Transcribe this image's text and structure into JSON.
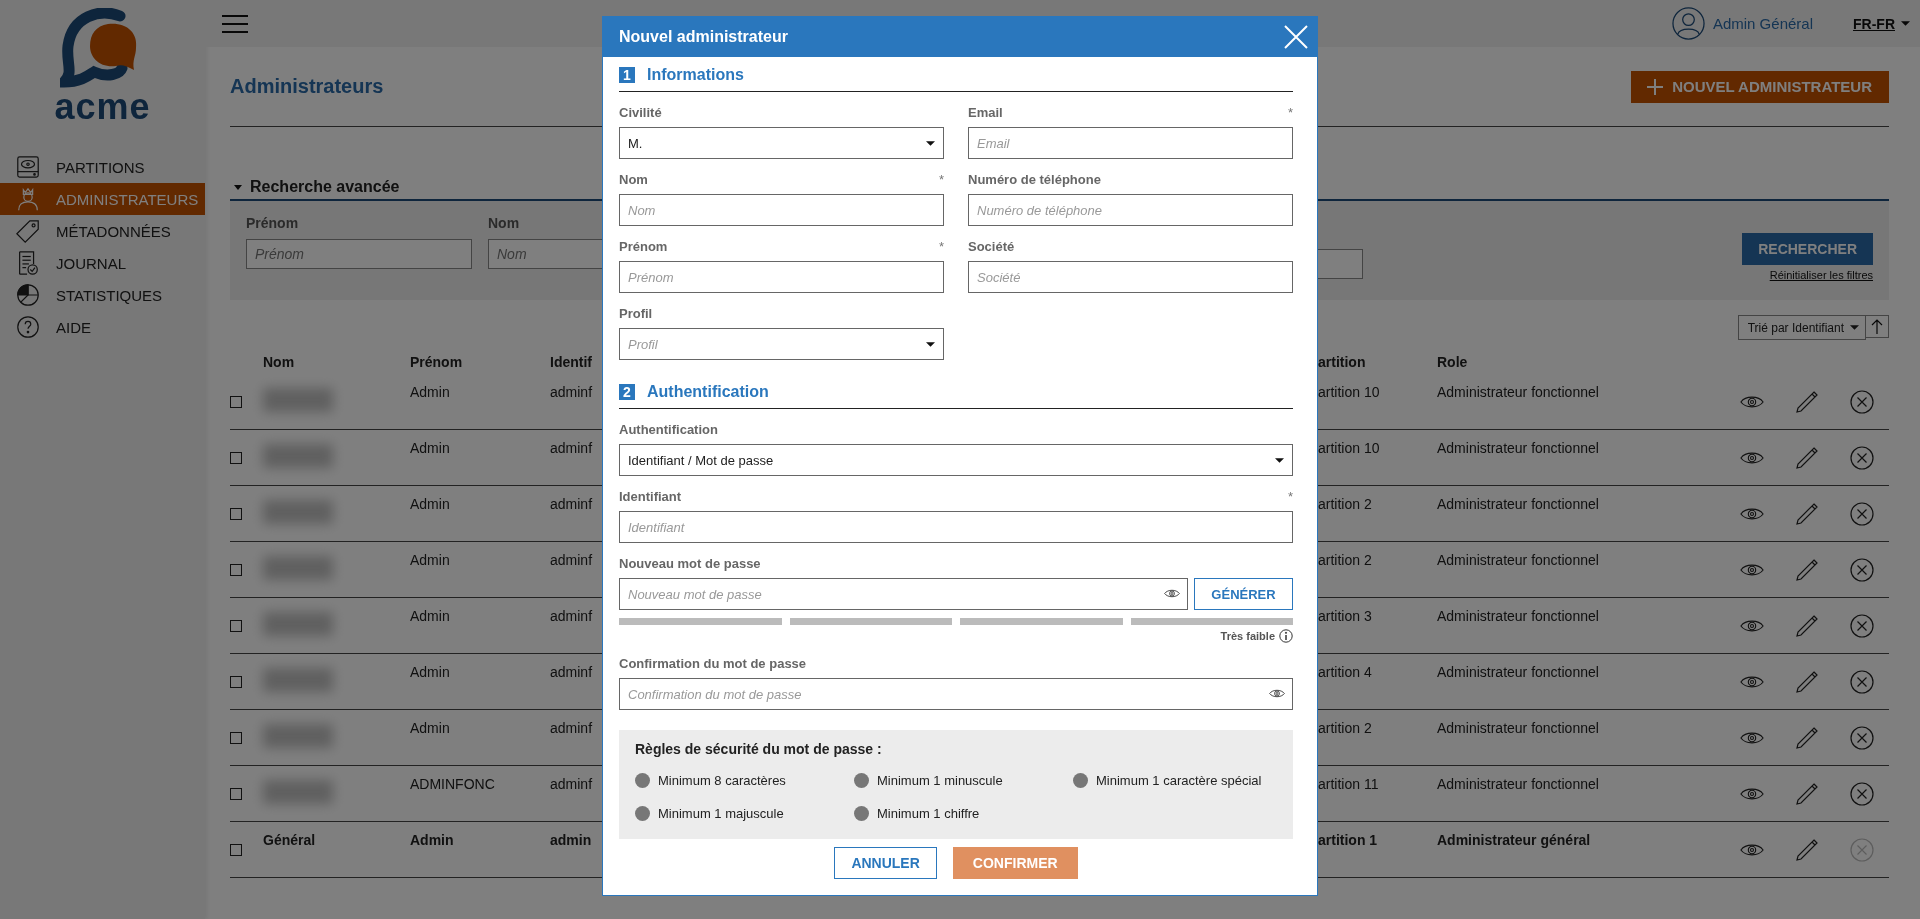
{
  "logo": {
    "text": "acme"
  },
  "sidebar": {
    "items": [
      {
        "label": "PARTITIONS",
        "selected": false
      },
      {
        "label": "ADMINISTRATEURS",
        "selected": true
      },
      {
        "label": "MÉTADONNÉES",
        "selected": false
      },
      {
        "label": "JOURNAL",
        "selected": false
      },
      {
        "label": "STATISTIQUES",
        "selected": false
      },
      {
        "label": "AIDE",
        "selected": false
      }
    ]
  },
  "header": {
    "user": "Admin Général",
    "language": "FR-FR"
  },
  "page": {
    "title": "Administrateurs",
    "new_button": "NOUVEL ADMINISTRATEUR"
  },
  "search": {
    "title": "Recherche avancée",
    "expanded": true,
    "fields": [
      {
        "label": "Prénom",
        "placeholder": "Prénom"
      },
      {
        "label": "Nom",
        "placeholder": "Nom"
      }
    ],
    "button": "RECHERCHER",
    "reset_link": "Réinitialiser les filtres"
  },
  "sort": {
    "value": "Trié par Identifiant"
  },
  "table": {
    "columns": [
      "Nom",
      "Prénom",
      "Identif",
      "artition",
      "Role"
    ],
    "rows": [
      {
        "checked": false,
        "nom_blurred": true,
        "emphasized": false,
        "prenom": "Admin",
        "identifiant": "adminf",
        "partition": "artition 10",
        "role": "Administrateur fonctionnel",
        "delete_disabled": false
      },
      {
        "checked": false,
        "nom_blurred": true,
        "emphasized": false,
        "prenom": "Admin",
        "identifiant": "adminf",
        "partition": "artition 10",
        "role": "Administrateur fonctionnel",
        "delete_disabled": false
      },
      {
        "checked": false,
        "nom_blurred": true,
        "emphasized": false,
        "prenom": "Admin",
        "identifiant": "adminf",
        "partition": "artition 2",
        "role": "Administrateur fonctionnel",
        "delete_disabled": false
      },
      {
        "checked": false,
        "nom_blurred": true,
        "emphasized": false,
        "prenom": "Admin",
        "identifiant": "adminf",
        "partition": "artition 2",
        "role": "Administrateur fonctionnel",
        "delete_disabled": false
      },
      {
        "checked": false,
        "nom_blurred": true,
        "emphasized": false,
        "prenom": "Admin",
        "identifiant": "adminf",
        "partition": "artition 3",
        "role": "Administrateur fonctionnel",
        "delete_disabled": false
      },
      {
        "checked": false,
        "nom_blurred": true,
        "emphasized": false,
        "prenom": "Admin",
        "identifiant": "adminf",
        "partition": "artition 4",
        "role": "Administrateur fonctionnel",
        "delete_disabled": false
      },
      {
        "checked": false,
        "nom_blurred": true,
        "emphasized": false,
        "prenom": "Admin",
        "identifiant": "adminf",
        "partition": "artition 2",
        "role": "Administrateur fonctionnel",
        "delete_disabled": false
      },
      {
        "checked": false,
        "nom_blurred": true,
        "emphasized": false,
        "prenom": "ADMINFONC",
        "identifiant": "adminf",
        "partition": "artition 11",
        "role": "Administrateur fonctionnel",
        "delete_disabled": false
      },
      {
        "checked": false,
        "nom_blurred": false,
        "nom": "Général",
        "emphasized": true,
        "prenom": "Admin",
        "identifiant": "admin",
        "partition": "artition 1",
        "role": "Administrateur général",
        "delete_disabled": true
      }
    ]
  },
  "dialog": {
    "title": "Nouvel administrateur",
    "section_1": {
      "number": "1",
      "title": "Informations",
      "fields": [
        {
          "kind": "select",
          "label": "Civilité",
          "value": "M."
        },
        {
          "kind": "text",
          "label": "Email",
          "placeholder": "Email",
          "required_mark": "*"
        },
        {
          "kind": "text",
          "label": "Nom",
          "placeholder": "Nom",
          "required_mark": "*"
        },
        {
          "kind": "text",
          "label": "Numéro de téléphone",
          "placeholder": "Numéro de téléphone"
        },
        {
          "kind": "text",
          "label": "Prénom",
          "placeholder": "Prénom",
          "required_mark": "*"
        },
        {
          "kind": "text",
          "label": "Société",
          "placeholder": "Société"
        },
        {
          "kind": "select",
          "label": "Profil",
          "placeholder": "Profil"
        }
      ]
    },
    "section_2": {
      "number": "2",
      "title": "Authentification",
      "fields": [
        {
          "kind": "select",
          "label": "Authentification",
          "value": "Identifiant / Mot de passe"
        },
        {
          "kind": "text",
          "label": "Identifiant",
          "placeholder": "Identifiant",
          "required_mark": "*"
        },
        {
          "kind": "password",
          "label": "Nouveau mot de passe",
          "placeholder": "Nouveau mot de passe",
          "button": "GÉNÉRER"
        },
        {
          "kind": "strength",
          "label": "Très faible"
        },
        {
          "kind": "password",
          "label": "Confirmation du mot de passe",
          "placeholder": "Confirmation du mot de passe"
        }
      ]
    },
    "rules": {
      "title": "Règles de sécurité du mot de passe :",
      "items": [
        {
          "label": "Minimum 8 caractères",
          "met": false
        },
        {
          "label": "Minimum 1 minuscule",
          "met": false
        },
        {
          "label": "Minimum 1 caractère spécial",
          "met": false
        },
        {
          "label": "Minimum 1 majuscule",
          "met": false
        },
        {
          "label": "Minimum 1 chiffre",
          "met": false
        }
      ]
    },
    "buttons": [
      {
        "label": "ANNULER",
        "kind": "secondary"
      },
      {
        "label": "CONFIRMER",
        "kind": "primary"
      }
    ]
  }
}
